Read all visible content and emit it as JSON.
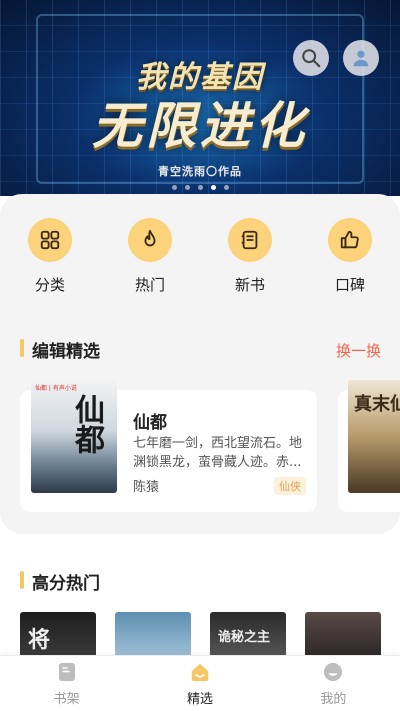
{
  "banner": {
    "title_line1": "我的基因",
    "title_line2": "无限进化",
    "author_line": "青空洗雨〇作品",
    "slide_count": 5,
    "active_slide": 3
  },
  "categories": [
    {
      "label": "分类",
      "icon": "grid-icon"
    },
    {
      "label": "热门",
      "icon": "fire-icon"
    },
    {
      "label": "新书",
      "icon": "notebook-icon"
    },
    {
      "label": "口碑",
      "icon": "thumbs-up-icon"
    }
  ],
  "editor_picks": {
    "title": "编辑精选",
    "swap_label": "换一换",
    "book": {
      "cover_brand": "仙都 | 有声小说",
      "cover_title": "仙都",
      "title": "仙都",
      "description": "七年磨一剑，西北望流石。地渊锁黑龙，蛮骨藏人迹。赤...",
      "author": "陈猿",
      "tag": "仙侠"
    },
    "next_cover_title": "真末仙"
  },
  "high_score": {
    "title": "高分热门",
    "covers": [
      "将",
      "",
      "诡秘之主",
      ""
    ]
  },
  "tabbar": {
    "items": [
      {
        "label": "书架",
        "icon": "bookshelf-icon",
        "active": false
      },
      {
        "label": "精选",
        "icon": "home-icon",
        "active": true
      },
      {
        "label": "我的",
        "icon": "profile-icon",
        "active": false
      }
    ]
  },
  "colors": {
    "accent_yellow": "#f7c763",
    "swap_red": "#f0664f",
    "tag_color": "#e0a34a"
  }
}
